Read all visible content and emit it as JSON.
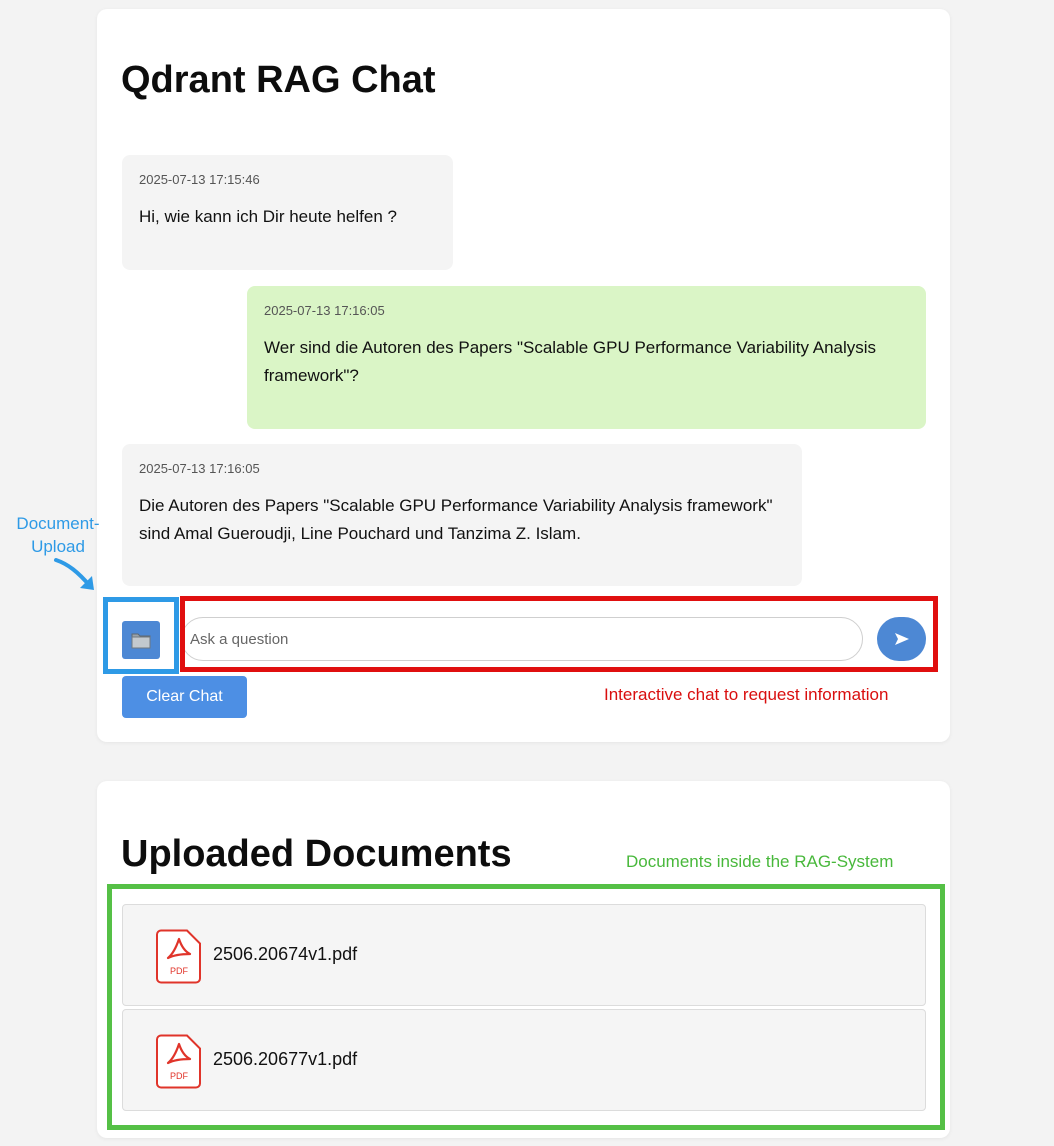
{
  "chat": {
    "title": "Qdrant RAG Chat",
    "messages": [
      {
        "role": "bot",
        "time": "2025-07-13 17:15:46",
        "text": "Hi, wie kann ich Dir heute helfen ?"
      },
      {
        "role": "user",
        "time": "2025-07-13 17:16:05",
        "text": "Wer sind die Autoren des Papers \"Scalable GPU Performance Variability Analysis framework\"?"
      },
      {
        "role": "bot",
        "time": "2025-07-13 17:16:05",
        "text": "Die Autoren des Papers \"Scalable GPU Performance Variability Analysis framework\" sind Amal Gueroudji, Line Pouchard und Tanzima Z. Islam."
      }
    ],
    "upload_icon": "folder-icon",
    "input_placeholder": "Ask a question",
    "input_value": "",
    "send_icon": "send-arrow-icon",
    "clear_label": "Clear Chat"
  },
  "documents": {
    "title": "Uploaded Documents",
    "items": [
      {
        "name": "2506.20674v1.pdf",
        "icon": "pdf-icon",
        "icon_label": "PDF"
      },
      {
        "name": "2506.20677v1.pdf",
        "icon": "pdf-icon",
        "icon_label": "PDF"
      }
    ]
  },
  "annotations": {
    "upload_label": "Document-Upload",
    "chat_label": "Interactive chat to request information",
    "docs_label": "Documents inside the RAG-System"
  },
  "colors": {
    "accent": "#4d88d4",
    "bot_bubble": "#f4f4f4",
    "user_bubble": "#daf5c6",
    "anno_blue": "#2e9ae6",
    "anno_red": "#e00f0f",
    "anno_green": "#55c046"
  }
}
